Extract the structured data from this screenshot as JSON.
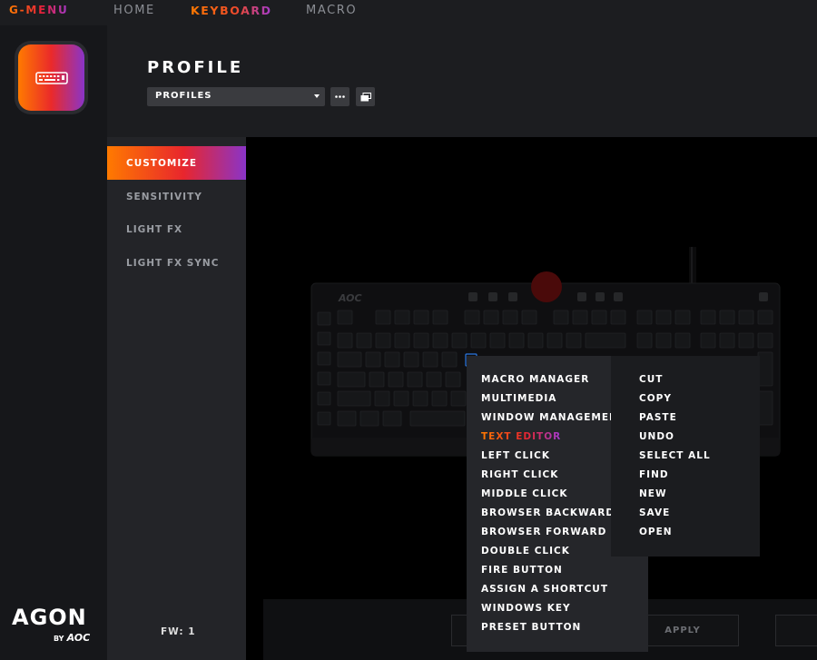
{
  "nav": {
    "gmenu": "G-MENU",
    "home": "HOME",
    "keyboard": "KEYBOARD",
    "macro": "MACRO"
  },
  "colors": {
    "accent_gradient": [
      "#ff7a00",
      "#e8262d",
      "#8a34c8"
    ],
    "panel_bg": "#1c1d20",
    "sidebar_bg": "#232428"
  },
  "brand": {
    "word": "AGON",
    "by": "BY",
    "maker": "AOC"
  },
  "header": {
    "title": "PROFILE",
    "profile_select": "PROFILES"
  },
  "keyboard": {
    "logo": "AOC"
  },
  "sidebar": {
    "items": [
      {
        "label": "CUSTOMIZE",
        "active": true
      },
      {
        "label": "SENSITIVITY",
        "active": false
      },
      {
        "label": "LIGHT FX",
        "active": false
      },
      {
        "label": "LIGHT FX SYNC",
        "active": false
      }
    ],
    "firmware": "FW: 1"
  },
  "bottom": {
    "apply": "APPLY"
  },
  "menu": {
    "items": [
      "MACRO MANAGER",
      "MULTIMEDIA",
      "WINDOW MANAGEMENT",
      "TEXT EDITOR",
      "LEFT CLICK",
      "RIGHT CLICK",
      "MIDDLE CLICK",
      "BROWSER BACKWARD",
      "BROWSER FORWARD",
      "DOUBLE CLICK",
      "FIRE BUTTON",
      "ASSIGN A SHORTCUT",
      "WINDOWS KEY",
      "PRESET BUTTON"
    ],
    "highlighted": "TEXT EDITOR"
  },
  "submenu": {
    "items": [
      "CUT",
      "COPY",
      "PASTE",
      "UNDO",
      "SELECT ALL",
      "FIND",
      "NEW",
      "SAVE",
      "OPEN"
    ]
  }
}
